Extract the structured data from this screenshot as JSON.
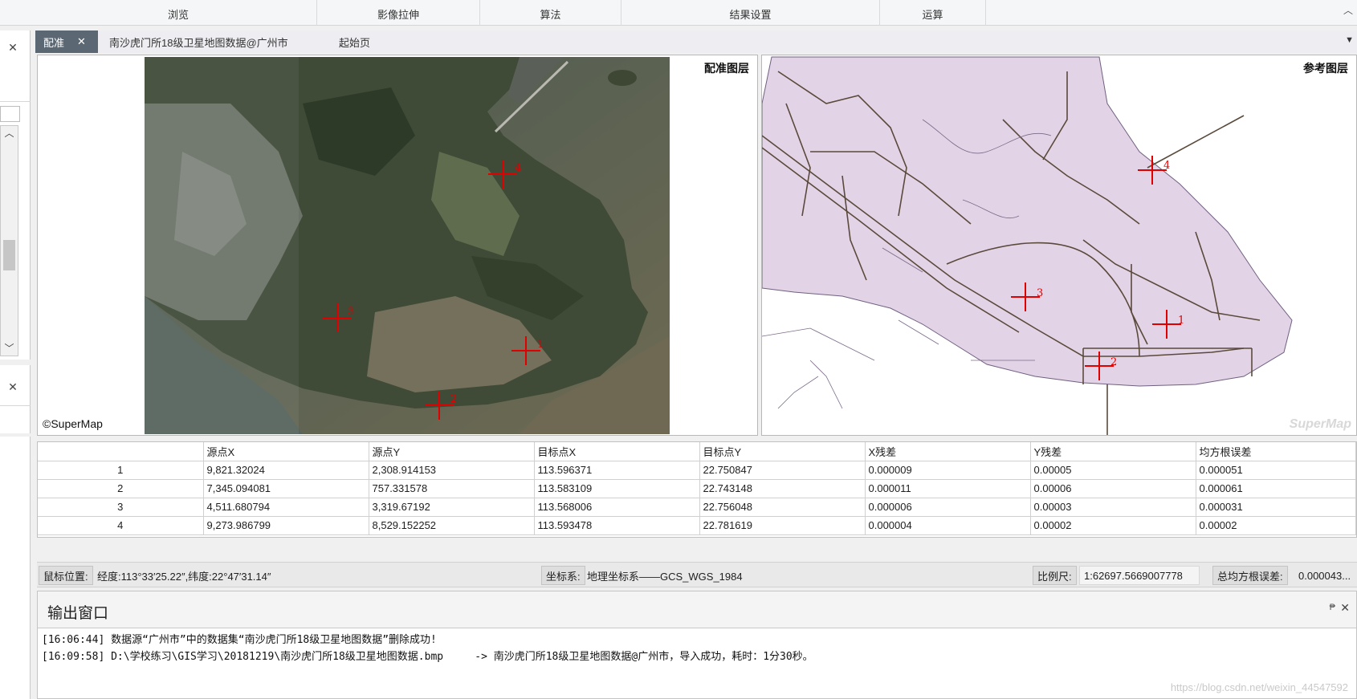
{
  "ribbon": {
    "groups": [
      "浏览",
      "影像拉伸",
      "算法",
      "结果设置",
      "运算"
    ]
  },
  "tabs": [
    {
      "label": "配准",
      "active": true
    },
    {
      "label": "南沙虎门所18级卫星地图数据@广州市",
      "active": false
    },
    {
      "label": "起始页",
      "active": false
    }
  ],
  "left_map": {
    "title": "配准图层",
    "copyright": "©SuperMap",
    "points": [
      "1",
      "2",
      "3",
      "4"
    ]
  },
  "right_map": {
    "title": "参考图层",
    "logo": "SuperMap",
    "points": [
      "1",
      "2",
      "3",
      "4"
    ],
    "fill_color": "#e3d3e6",
    "road_color": "#5a4a3c"
  },
  "control_points": {
    "columns": [
      "",
      "源点X",
      "源点Y",
      "目标点X",
      "目标点Y",
      "X残差",
      "Y残差",
      "均方根误差"
    ],
    "rows": [
      [
        "1",
        "9,821.32024",
        "2,308.914153",
        "113.596371",
        "22.750847",
        "0.000009",
        "0.00005",
        "0.000051"
      ],
      [
        "2",
        "7,345.094081",
        "757.331578",
        "113.583109",
        "22.743148",
        "0.000011",
        "0.00006",
        "0.000061"
      ],
      [
        "3",
        "4,511.680794",
        "3,319.67192",
        "113.568006",
        "22.756048",
        "0.000006",
        "0.00003",
        "0.000031"
      ],
      [
        "4",
        "9,273.986799",
        "8,529.152252",
        "113.593478",
        "22.781619",
        "0.000004",
        "0.00002",
        "0.00002"
      ]
    ]
  },
  "status": {
    "mouse_label": "鼠标位置:",
    "mouse_value": "经度:113°33′25.22″,纬度:22°47′31.14″",
    "crs_label": "坐标系:",
    "crs_value": "地理坐标系——GCS_WGS_1984",
    "scale_label": "比例尺:",
    "scale_value": "1:62697.5669007778",
    "rmse_label": "总均方根误差:",
    "rmse_value": "0.000043..."
  },
  "output": {
    "title": "输出窗口",
    "lines": [
      "[16:06:44] 数据源“广州市”中的数据集“南沙虎门所18级卫星地图数据”删除成功!",
      "[16:09:58] D:\\学校练习\\GIS学习\\20181219\\南沙虎门所18级卫星地图数据.bmp     -> 南沙虎门所18级卫星地图数据@广州市，导入成功，耗时：1分30秒。"
    ],
    "watermark": "https://blog.csdn.net/weixin_44547592"
  },
  "colors": {
    "accent_tab": "#5b6773",
    "marker": "#e00000"
  }
}
